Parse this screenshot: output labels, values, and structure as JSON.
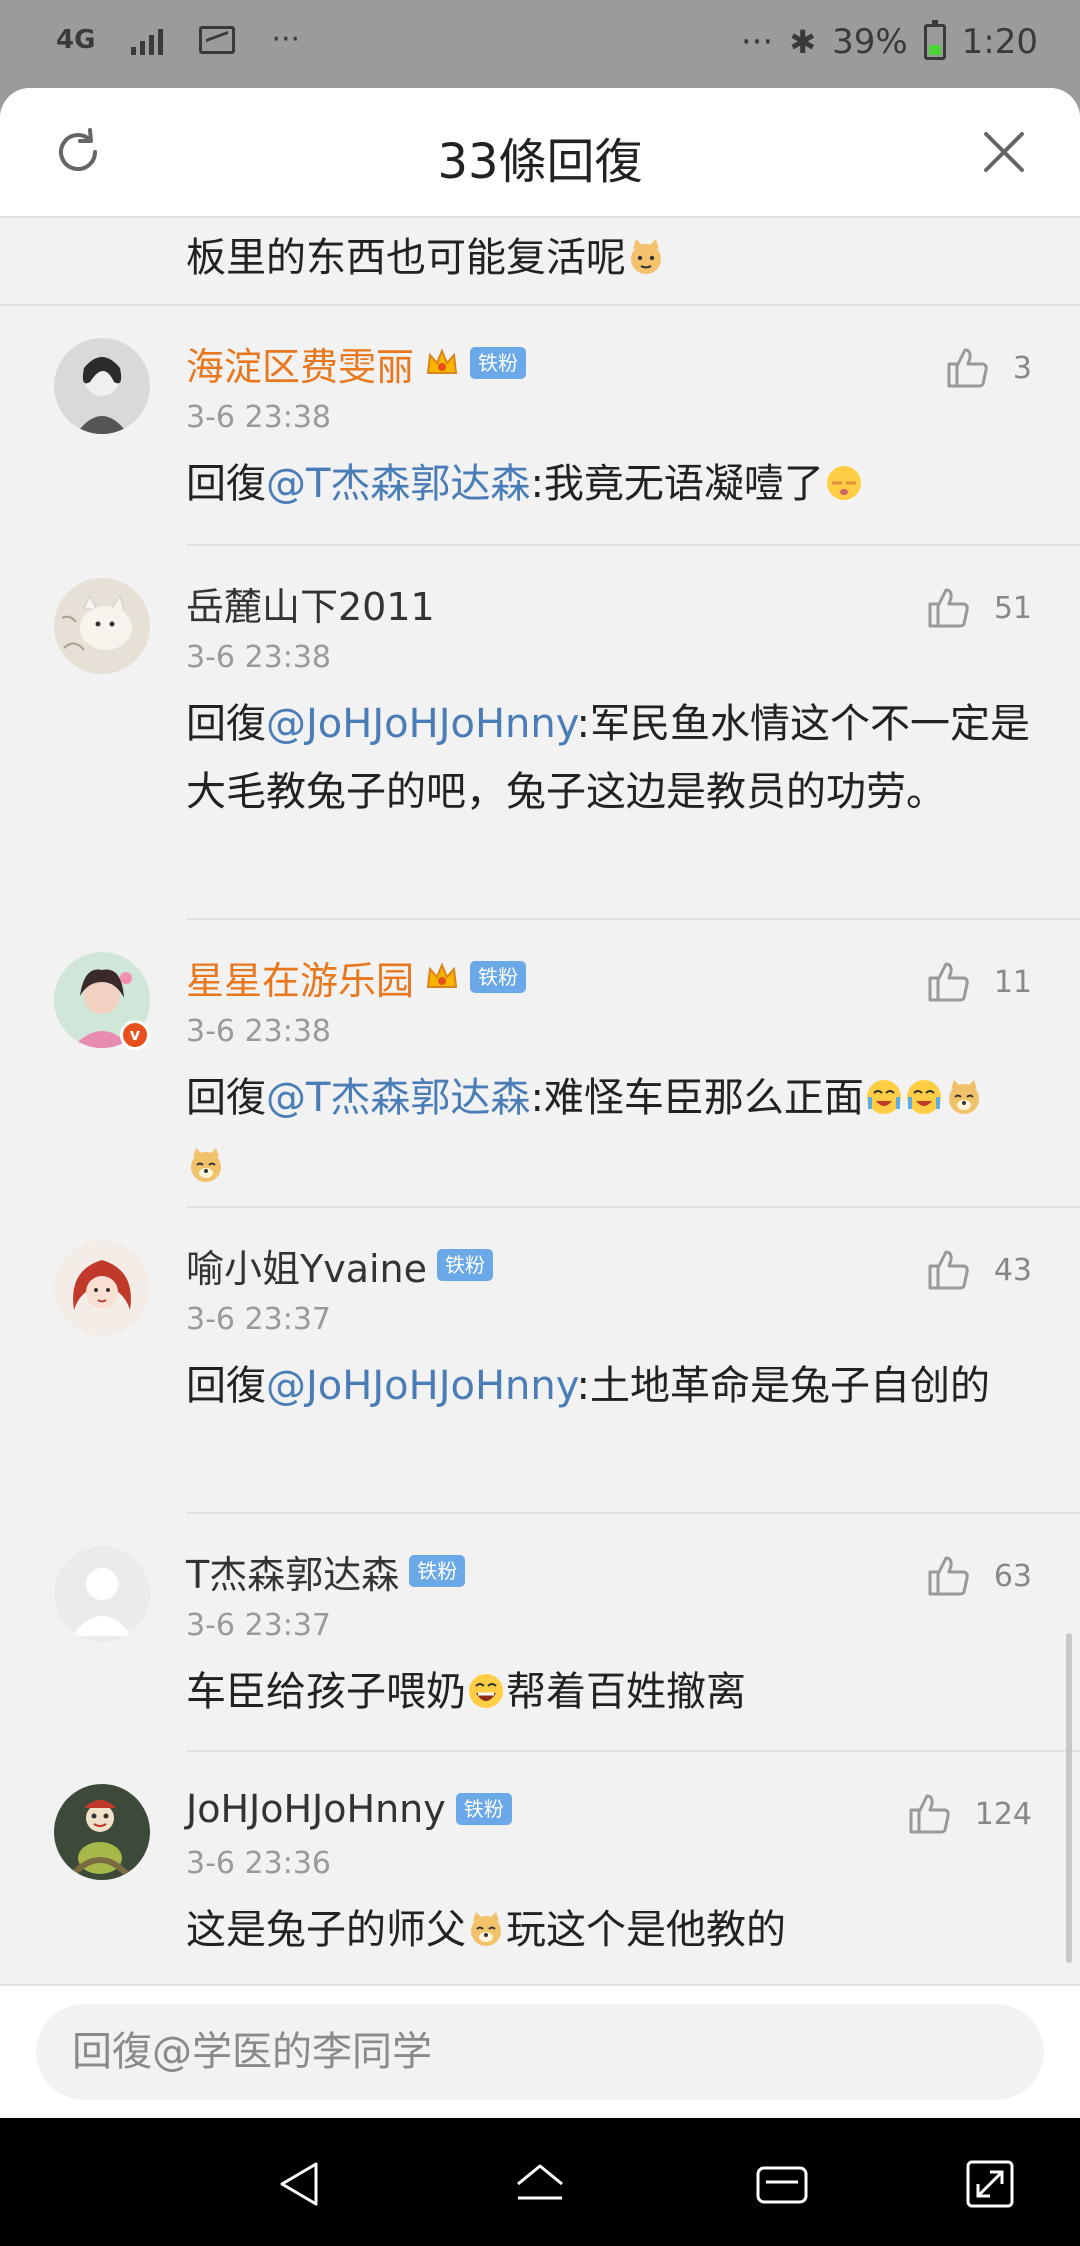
{
  "status_bar": {
    "network": "4G",
    "more": "···",
    "more_right": "···",
    "battery": "39%",
    "time": "1:20"
  },
  "sheet": {
    "title": "33條回復"
  },
  "prev_tail": {
    "text": "板里的东西也可能复活呢"
  },
  "comments": [
    {
      "name": "海淀区费雯丽",
      "badge": "铁粉",
      "time": "3-6 23:38",
      "likes": "3",
      "prefix": "回復",
      "mention": "@T杰森郭达森",
      "text": ":我竟无语凝噎了"
    },
    {
      "name": "岳麓山下2011",
      "badge": "",
      "time": "3-6 23:38",
      "likes": "51",
      "prefix": "回復",
      "mention": "@JoHJoHJoHnny",
      "text": ":军民鱼水情这个不一定是大毛教兔子的吧，兔子这边是教员的功劳。"
    },
    {
      "name": "星星在游乐园",
      "badge": "铁粉",
      "time": "3-6 23:38",
      "likes": "11",
      "prefix": "回復",
      "mention": "@T杰森郭达森",
      "text": ":难怪车臣那么正面"
    },
    {
      "name": "喻小姐Yvaine",
      "badge": "铁粉",
      "time": "3-6 23:37",
      "likes": "43",
      "prefix": "回復",
      "mention": "@JoHJoHJoHnny",
      "text": ":土地革命是兔子自创的"
    },
    {
      "name": "T杰森郭达森",
      "badge": "铁粉",
      "time": "3-6 23:37",
      "likes": "63",
      "text_a": "车臣给孩子喂奶",
      "text_b": "帮着百姓撤离"
    },
    {
      "name": "JoHJoHJoHnny",
      "badge": "铁粉",
      "time": "3-6 23:36",
      "likes": "124",
      "text_a": "这是兔子的师父",
      "text_b": "玩这个是他教的"
    }
  ],
  "footer": {
    "placeholder": "回復@学医的李同学"
  },
  "colors": {
    "vip_name": "#e8771e",
    "mention": "#4a7db7",
    "fan_badge": "#6aa8e8",
    "background": "#f2f2f2"
  }
}
